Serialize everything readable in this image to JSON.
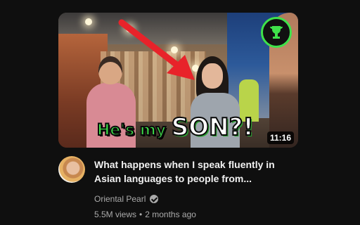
{
  "video": {
    "thumbnail": {
      "headline_part1": "He's my ",
      "headline_part2": "SON?!",
      "duration": "11:16",
      "logo_icon": "trophy-icon",
      "arrow_color": "#e8232a",
      "accent_color": "#3fe24a"
    },
    "title": "What happens when I speak fluently in Asian languages to people from...",
    "channel": {
      "name": "Oriental Pearl",
      "verified_icon": "verified-check-icon"
    },
    "views": "5.5M views",
    "separator": "•",
    "age": "2 months ago"
  }
}
